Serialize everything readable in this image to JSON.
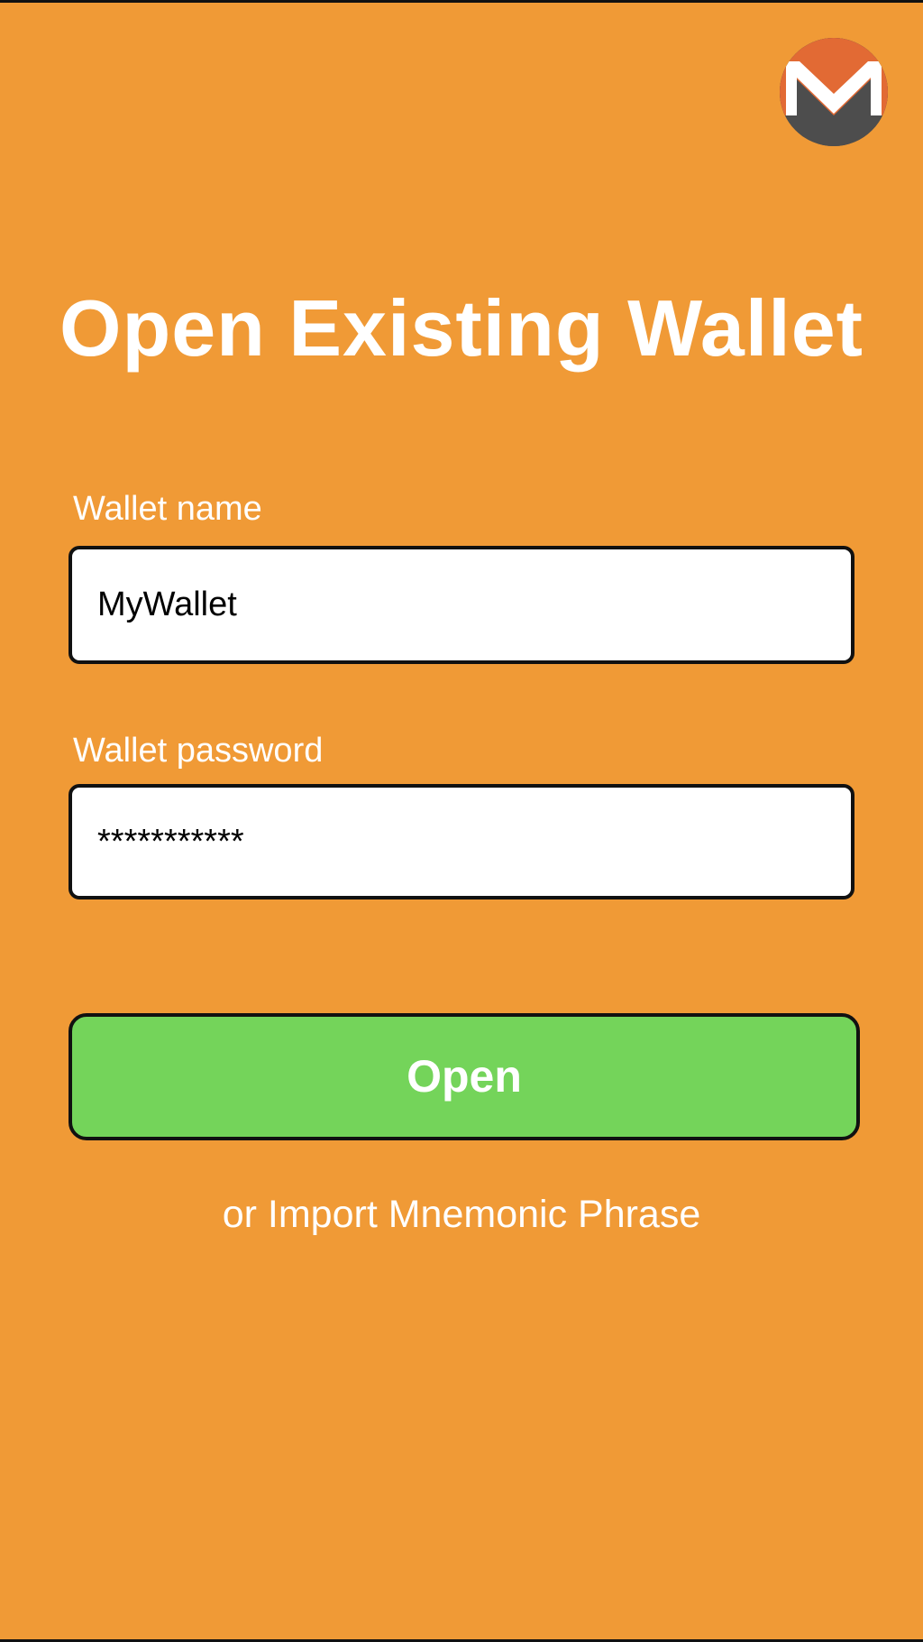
{
  "screen": {
    "background_color": "#f09a36",
    "title": "Open Existing Wallet"
  },
  "logo": {
    "icon": "monero-logo-icon",
    "colors": [
      "#e26a34",
      "#4d4d4d",
      "#ffffff"
    ]
  },
  "form": {
    "wallet_name": {
      "label": "Wallet name",
      "value": "MyWallet"
    },
    "wallet_password": {
      "label": "Wallet password",
      "value": "***********"
    }
  },
  "actions": {
    "open_label": "Open",
    "open_color": "#74d45a",
    "import_label": "or Import Mnemonic Phrase"
  }
}
